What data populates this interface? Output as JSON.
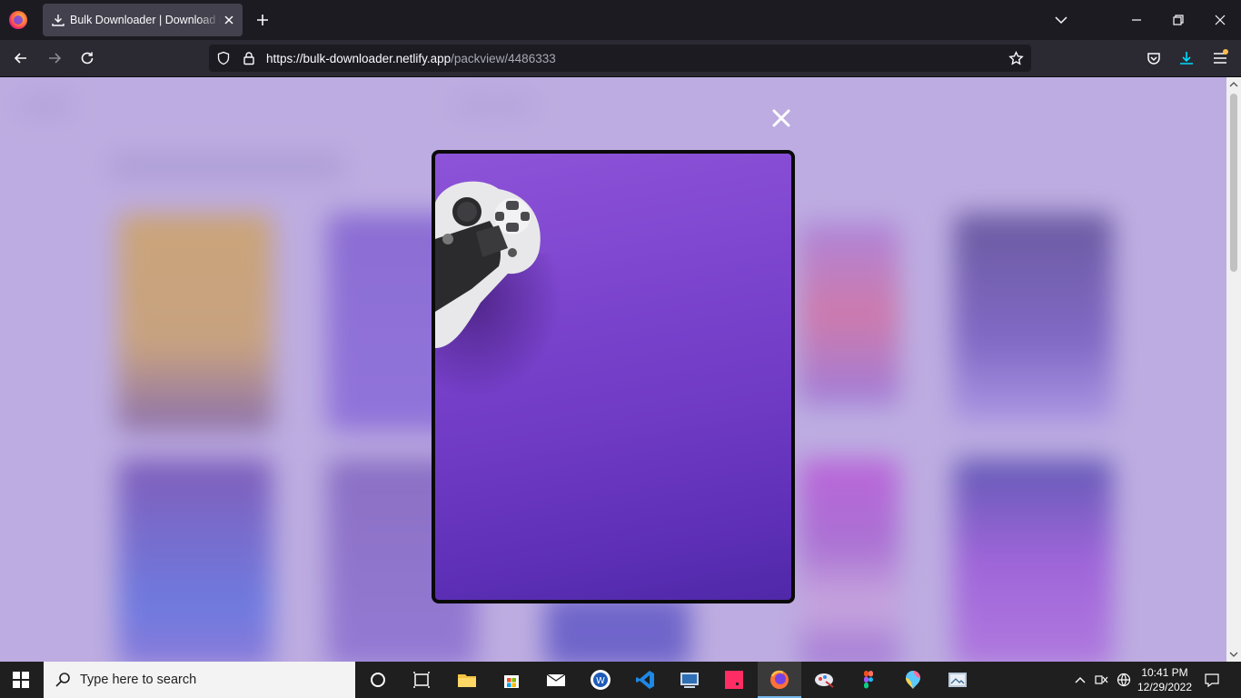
{
  "browser": {
    "tab_title": "Bulk Downloader | Download bulk",
    "url_host": "https://bulk-downloader.netlify.app",
    "url_path": "/packview/4486333"
  },
  "taskbar": {
    "search_placeholder": "Type here to search",
    "time": "10:41 PM",
    "date": "12/29/2022"
  },
  "colors": {
    "page_background": "#b7a7dc",
    "modal_image_top": "#8d53d8",
    "modal_image_bottom": "#4f28a8",
    "accent": "#76b9ed"
  }
}
